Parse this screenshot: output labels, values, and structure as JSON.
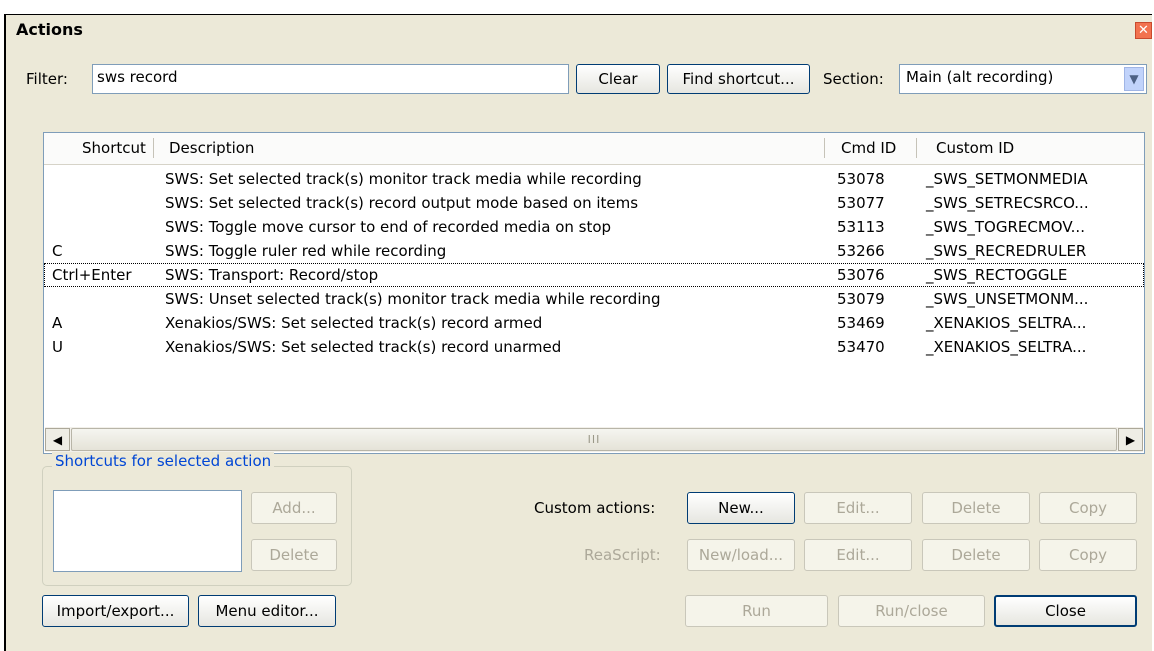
{
  "window": {
    "title": "Actions",
    "close_glyph": "✕"
  },
  "filter": {
    "label": "Filter:",
    "value": "sws record",
    "clear_label": "Clear",
    "find_shortcut_label": "Find shortcut..."
  },
  "section": {
    "label": "Section:",
    "value": "Main (alt recording)",
    "dropdown_icon": "chevron-down-icon"
  },
  "list": {
    "headers": {
      "shortcut": "Shortcut",
      "description": "Description",
      "cmd_id": "Cmd ID",
      "custom_id": "Custom ID"
    },
    "rows": [
      {
        "shortcut": "",
        "description": "SWS: Set selected track(s) monitor track media while recording",
        "cmd_id": "53078",
        "custom_id": "_SWS_SETMONMEDIA"
      },
      {
        "shortcut": "",
        "description": "SWS: Set selected track(s) record output mode based on items",
        "cmd_id": "53077",
        "custom_id": "_SWS_SETRECSRCO..."
      },
      {
        "shortcut": "",
        "description": "SWS: Toggle move cursor to end of recorded media on stop",
        "cmd_id": "53113",
        "custom_id": "_SWS_TOGRECMOV..."
      },
      {
        "shortcut": "C",
        "description": "SWS: Toggle ruler red while recording",
        "cmd_id": "53266",
        "custom_id": "_SWS_RECREDRULER"
      },
      {
        "shortcut": "Ctrl+Enter",
        "description": "SWS: Transport: Record/stop",
        "cmd_id": "53076",
        "custom_id": "_SWS_RECTOGGLE"
      },
      {
        "shortcut": "",
        "description": "SWS: Unset selected track(s) monitor track media while recording",
        "cmd_id": "53079",
        "custom_id": "_SWS_UNSETMONM..."
      },
      {
        "shortcut": "A",
        "description": "Xenakios/SWS: Set selected track(s) record armed",
        "cmd_id": "53469",
        "custom_id": "_XENAKIOS_SELTRA..."
      },
      {
        "shortcut": "U",
        "description": "Xenakios/SWS: Set selected track(s) record unarmed",
        "cmd_id": "53470",
        "custom_id": "_XENAKIOS_SELTRA..."
      }
    ],
    "scroll_left": "◀",
    "scroll_right": "▶",
    "thumb_grip": "III"
  },
  "shortcuts_group": {
    "title": "Shortcuts for selected action",
    "add_label": "Add...",
    "delete_label": "Delete"
  },
  "custom_actions": {
    "label": "Custom actions:",
    "new_label": "New...",
    "edit_label": "Edit...",
    "delete_label": "Delete",
    "copy_label": "Copy"
  },
  "reascript": {
    "label": "ReaScript:",
    "new_load_label": "New/load...",
    "edit_label": "Edit...",
    "delete_label": "Delete",
    "copy_label": "Copy"
  },
  "footer": {
    "import_export_label": "Import/export...",
    "menu_editor_label": "Menu editor...",
    "run_label": "Run",
    "run_close_label": "Run/close",
    "close_label": "Close"
  }
}
